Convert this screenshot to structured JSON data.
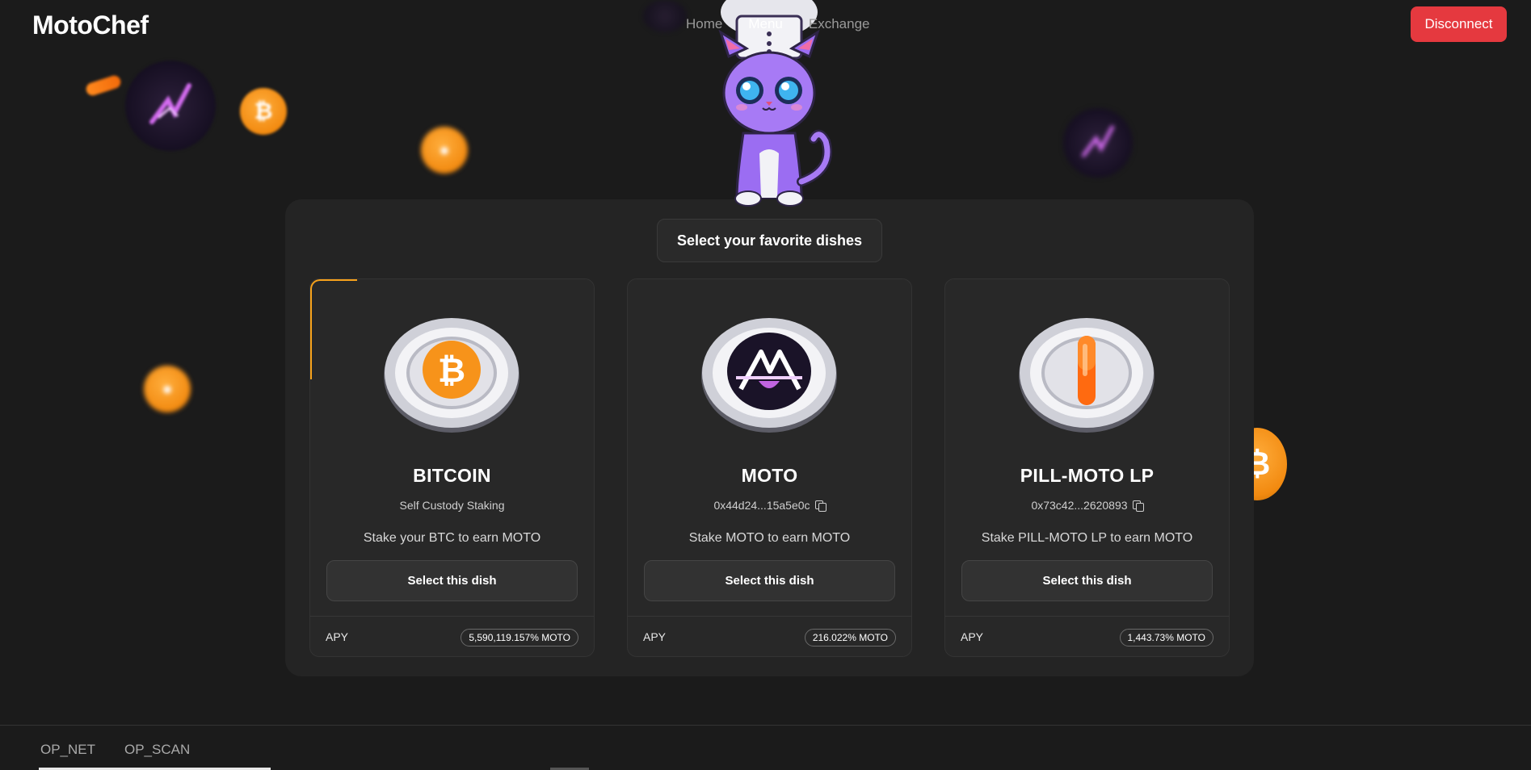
{
  "header": {
    "logo": "MotoChef",
    "nav": [
      {
        "label": "Home"
      },
      {
        "label": "Menu",
        "active": true
      },
      {
        "label": "Exchange"
      }
    ],
    "disconnect_label": "Disconnect"
  },
  "panel": {
    "title": "Select your favorite dishes",
    "cards": [
      {
        "name": "BITCOIN",
        "subtitle": "Self Custody Staking",
        "description": "Stake your BTC to earn MOTO",
        "button": "Select this dish",
        "apy_label": "APY",
        "apy_value": "5,590,119.157% MOTO",
        "icon": "bitcoin-icon"
      },
      {
        "name": "MOTO",
        "subtitle": "0x44d24...15a5e0c",
        "description": "Stake MOTO to earn MOTO",
        "button": "Select this dish",
        "apy_label": "APY",
        "apy_value": "216.022% MOTO",
        "icon": "moto-icon"
      },
      {
        "name": "PILL-MOTO LP",
        "subtitle": "0x73c42...2620893",
        "description": "Stake PILL-MOTO LP to earn MOTO",
        "button": "Select this dish",
        "apy_label": "APY",
        "apy_value": "1,443.73% MOTO",
        "icon": "pill-icon"
      }
    ]
  },
  "footer": {
    "tabs": [
      {
        "label": "OP_NET"
      },
      {
        "label": "OP_SCAN"
      }
    ]
  },
  "colors": {
    "background": "#1b1b1b",
    "panel": "#242424",
    "accent_orange": "#f7a21b",
    "disconnect_red": "#e5393f",
    "moto_purple": "#8a4fd8"
  }
}
